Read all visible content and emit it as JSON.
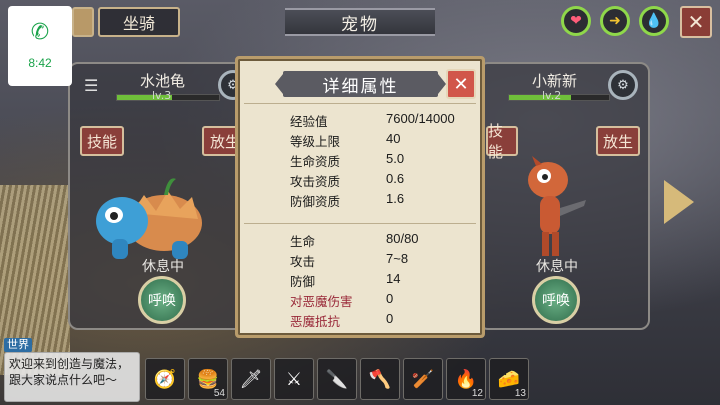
{
  "call": {
    "icon": "phone-icon",
    "time": "8:42"
  },
  "top_bar": {
    "tab_mount": "坐骑",
    "title": "宠物",
    "buttons": [
      {
        "name": "heart-icon",
        "glyph": "❤"
      },
      {
        "name": "feed-icon",
        "glyph": "➜"
      },
      {
        "name": "water-drop-icon",
        "glyph": "💧"
      }
    ],
    "close_glyph": "✕"
  },
  "pets": {
    "left": {
      "name": "水池龟",
      "level": "lv.3",
      "exp_progress": 0.54,
      "skill_button": "技能",
      "release_button": "放生",
      "status": "休息中",
      "summon_button": "呼唤"
    },
    "right": {
      "name": "小新新",
      "level": "lv.2",
      "exp_progress": 0.62,
      "skill_button": "技能",
      "release_button": "放生",
      "status": "休息中",
      "summon_button": "呼唤"
    }
  },
  "detail_modal": {
    "title": "详细属性",
    "close_glyph": "✕",
    "growth_stats": [
      {
        "label": "经验值",
        "value": "7600/14000"
      },
      {
        "label": "等级上限",
        "value": "40"
      },
      {
        "label": "生命资质",
        "value": "5.0"
      },
      {
        "label": "攻击资质",
        "value": "0.6"
      },
      {
        "label": "防御资质",
        "value": "1.6"
      }
    ],
    "combat_stats": [
      {
        "label": "生命",
        "value": "80/80"
      },
      {
        "label": "攻击",
        "value": "7~8"
      },
      {
        "label": "防御",
        "value": "14"
      },
      {
        "label": "对恶魔伤害",
        "value": "0",
        "highlight": true
      },
      {
        "label": "恶魔抵抗",
        "value": "0",
        "highlight": true
      }
    ]
  },
  "chat": {
    "channel": "世界",
    "message": "欢迎来到创造与魔法，跟大家说点什么吧～"
  },
  "hotbar": [
    {
      "icon": "compass-icon",
      "glyph": "🧭",
      "count": ""
    },
    {
      "icon": "burger-icon",
      "glyph": "🍔",
      "count": "54"
    },
    {
      "icon": "spear-icon",
      "glyph": "🗡",
      "count": ""
    },
    {
      "icon": "sickle-icon",
      "glyph": "⚔",
      "count": ""
    },
    {
      "icon": "knife-icon",
      "glyph": "🔪",
      "count": ""
    },
    {
      "icon": "axe-icon",
      "glyph": "🪓",
      "count": ""
    },
    {
      "icon": "club-icon",
      "glyph": "🏏",
      "count": ""
    },
    {
      "icon": "torch-icon",
      "glyph": "🔥",
      "count": "12"
    },
    {
      "icon": "cheese-icon",
      "glyph": "🧀",
      "count": "13"
    }
  ]
}
